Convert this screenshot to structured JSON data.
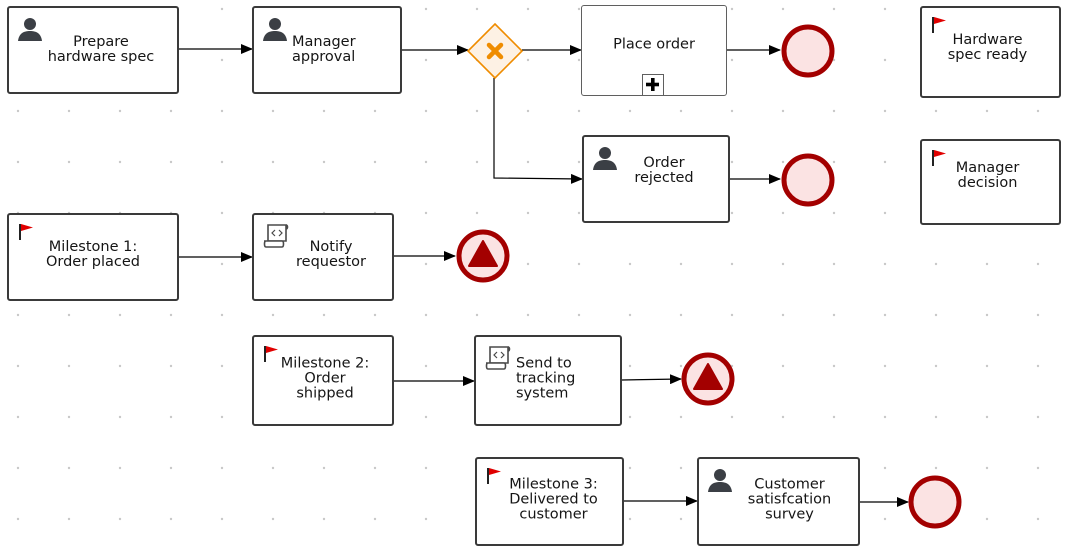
{
  "diagram": {
    "type": "BPMN process",
    "colors": {
      "task_border": "#3a3a3a",
      "user_icon": "#3b3f45",
      "milestone_flag": "#e00000",
      "gateway_stroke": "#ef8c00",
      "gateway_fill": "#fdf1e4",
      "end_event_stroke": "#a30000",
      "end_event_fill": "#fbe3e3",
      "grid_dot": "#c8c8c8"
    },
    "nodes": {
      "prepare_spec": {
        "label": "Prepare\nhardware spec",
        "kind": "user-task"
      },
      "manager_approval": {
        "label": "Manager\napproval",
        "kind": "user-task"
      },
      "gateway": {
        "label": "",
        "kind": "exclusive-gateway"
      },
      "place_order": {
        "label": "Place order",
        "kind": "sub-process"
      },
      "order_rejected": {
        "label": "Order\nrejected",
        "kind": "user-task"
      },
      "hw_spec_ready": {
        "label": "Hardware\nspec ready",
        "kind": "milestone"
      },
      "manager_decision": {
        "label": "Manager\ndecision",
        "kind": "milestone"
      },
      "milestone1": {
        "label": "Milestone 1:\nOrder placed",
        "kind": "milestone"
      },
      "notify_requestor": {
        "label": "Notify\nrequestor",
        "kind": "script-task"
      },
      "milestone2": {
        "label": "Milestone 2:\nOrder\nshipped",
        "kind": "milestone"
      },
      "send_tracking": {
        "label": "Send to\ntracking\nsystem",
        "kind": "script-task"
      },
      "milestone3": {
        "label": "Milestone 3:\nDelivered to\ncustomer",
        "kind": "milestone"
      },
      "survey": {
        "label": "Customer\nsatisfcation\nsurvey",
        "kind": "user-task"
      },
      "end1": {
        "kind": "end-event"
      },
      "end2": {
        "kind": "end-event"
      },
      "end3": {
        "kind": "escalation-end-event"
      },
      "end4": {
        "kind": "escalation-end-event"
      },
      "end5": {
        "kind": "end-event"
      }
    },
    "flows": [
      [
        "prepare_spec",
        "manager_approval"
      ],
      [
        "manager_approval",
        "gateway"
      ],
      [
        "gateway",
        "place_order"
      ],
      [
        "gateway",
        "order_rejected"
      ],
      [
        "place_order",
        "end1"
      ],
      [
        "order_rejected",
        "end2"
      ],
      [
        "milestone1",
        "notify_requestor"
      ],
      [
        "notify_requestor",
        "end3"
      ],
      [
        "milestone2",
        "send_tracking"
      ],
      [
        "send_tracking",
        "end4"
      ],
      [
        "milestone3",
        "survey"
      ],
      [
        "survey",
        "end5"
      ]
    ]
  }
}
